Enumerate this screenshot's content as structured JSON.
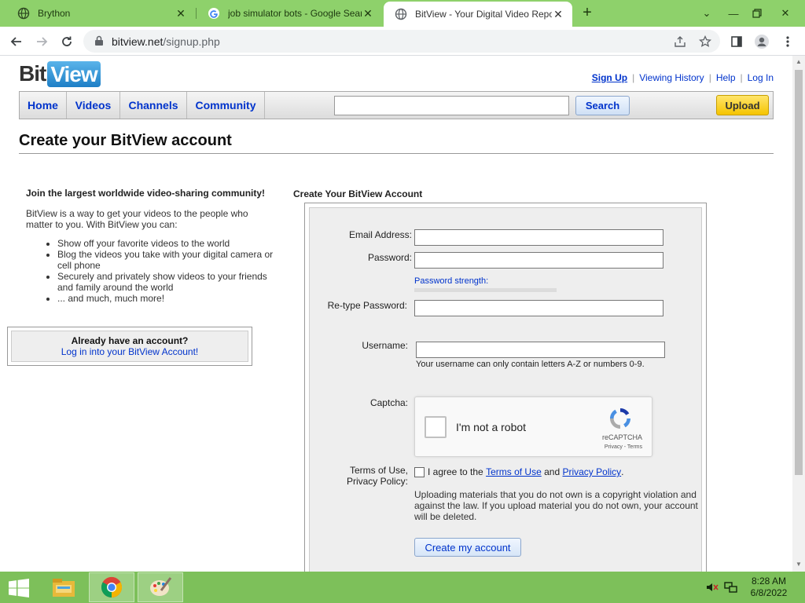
{
  "browser": {
    "tabs": [
      {
        "title": "Brython",
        "icon": "globe-icon"
      },
      {
        "title": "job simulator bots - Google Search",
        "icon": "google-icon"
      },
      {
        "title": "BitView - Your Digital Video Repository",
        "icon": "globe-icon",
        "active": true
      }
    ],
    "url_host": "bitview.net",
    "url_path": "/signup.php"
  },
  "site": {
    "logo_left": "Bit",
    "logo_right": "View",
    "toplinks": {
      "signup": "Sign Up",
      "history": "Viewing History",
      "help": "Help",
      "login": "Log In"
    },
    "nav": {
      "home": "Home",
      "videos": "Videos",
      "channels": "Channels",
      "community": "Community"
    },
    "search_button": "Search",
    "upload_button": "Upload",
    "page_title": "Create your BitView account"
  },
  "left": {
    "heading": "Join the largest worldwide video-sharing community!",
    "intro": "BitView is a way to get your videos to the people who matter to you. With BitView you can:",
    "bullets": [
      "Show off your favorite videos to the world",
      "Blog the videos you take with your digital camera or cell phone",
      "Securely and privately show videos to your friends and family around the world",
      "... and much, much more!"
    ],
    "login_question": "Already have an account?",
    "login_link": "Log in into your BitView Account!"
  },
  "form": {
    "title": "Create Your BitView Account",
    "email_label": "Email Address:",
    "password_label": "Password:",
    "strength_label": "Password strength:",
    "retype_label": "Re-type Password:",
    "username_label": "Username:",
    "username_hint": "Your username can only contain letters A-Z or numbers 0-9.",
    "captcha_label": "Captcha:",
    "captcha_text": "I'm not a robot",
    "captcha_brand": "reCAPTCHA",
    "captcha_privacy": "Privacy - Terms",
    "terms_label_1": "Terms of Use,",
    "terms_label_2": "Privacy Policy:",
    "agree_prefix": "I agree to the",
    "agree_terms": "Terms of Use",
    "agree_and": "and",
    "agree_privacy": "Privacy Policy",
    "warning": "Uploading materials that you do not own is a copyright violation and against the law. If you upload material you do not own, your account will be deleted.",
    "submit": "Create my account"
  },
  "taskbar": {
    "time": "8:28 AM",
    "date": "6/8/2022"
  },
  "colors": {
    "chrome_frame": "#8ed16b",
    "taskbar": "#7dc05a",
    "link": "#0033cc",
    "upload": "#f5c400"
  }
}
